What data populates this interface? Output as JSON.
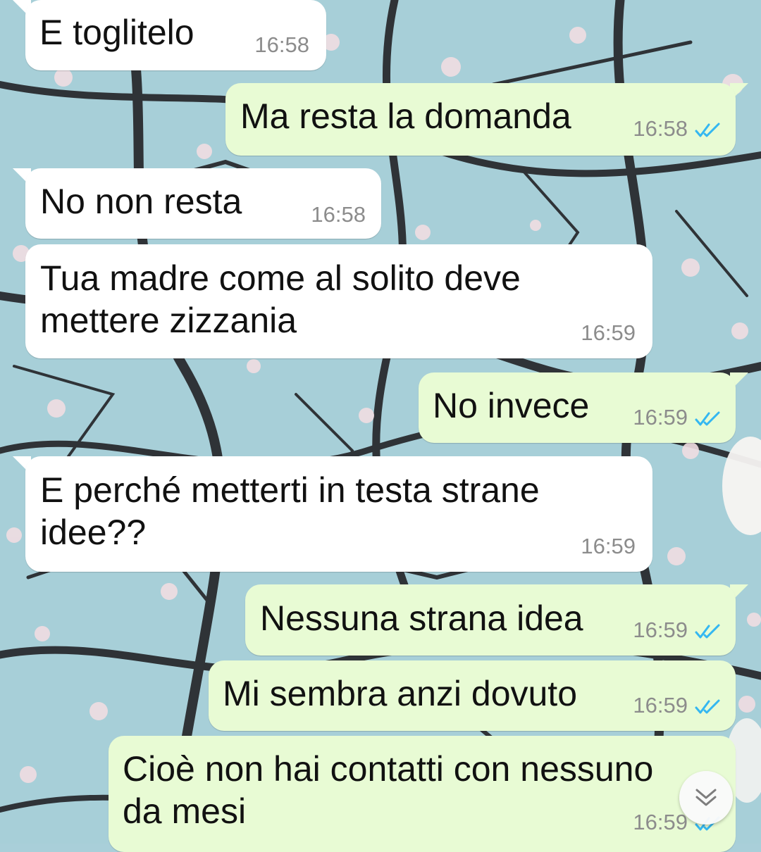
{
  "messages": [
    {
      "direction": "incoming",
      "lines": [
        "E toglitelo"
      ],
      "time": "16:58"
    },
    {
      "direction": "outgoing",
      "lines": [
        "Ma resta la domanda"
      ],
      "time": "16:58",
      "status": "read"
    },
    {
      "direction": "incoming",
      "lines": [
        "No non resta"
      ],
      "time": "16:58"
    },
    {
      "direction": "incoming",
      "lines": [
        "Tua madre come al solito deve",
        "mettere zizzania"
      ],
      "time": "16:59"
    },
    {
      "direction": "outgoing",
      "lines": [
        "No invece"
      ],
      "time": "16:59",
      "status": "read"
    },
    {
      "direction": "incoming",
      "lines": [
        "E perché metterti in testa strane",
        "idee??"
      ],
      "time": "16:59"
    },
    {
      "direction": "outgoing",
      "lines": [
        "Nessuna strana idea"
      ],
      "time": "16:59",
      "status": "read"
    },
    {
      "direction": "outgoing",
      "lines": [
        "Mi sembra anzi dovuto"
      ],
      "time": "16:59",
      "status": "read"
    },
    {
      "direction": "outgoing",
      "lines": [
        "Cioè non hai contatti con nessuno",
        "da mesi"
      ],
      "time": "16:59",
      "status": "read"
    }
  ],
  "icons": {
    "read_receipt": "double-check-icon",
    "scroll_down": "chevron-double-down-icon"
  },
  "colors": {
    "incoming_bubble": "#ffffff",
    "outgoing_bubble": "#e8fbd4",
    "read_check": "#34b7f1",
    "timestamp": "#8c8c8c"
  }
}
